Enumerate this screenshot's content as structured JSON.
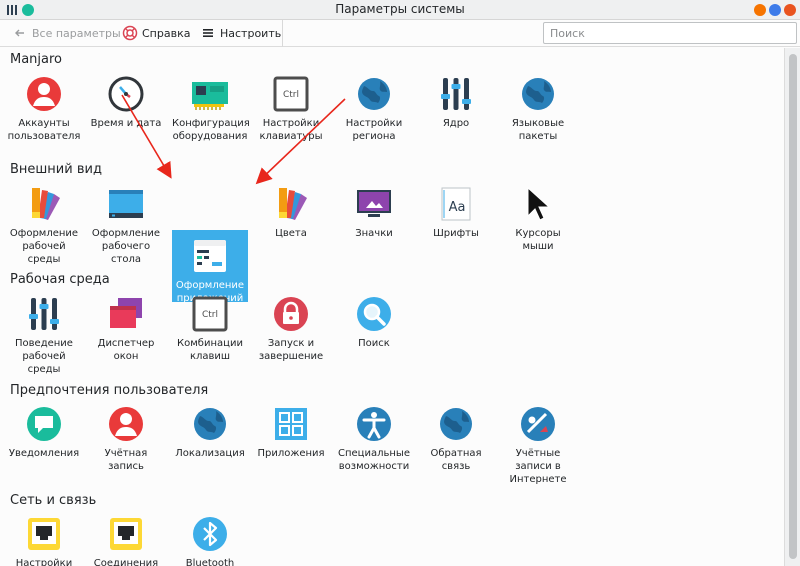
{
  "window": {
    "title": "Параметры системы"
  },
  "toolbar": {
    "back_label": "Все параметры",
    "help_label": "Справка",
    "configure_label": "Настроить",
    "search_placeholder": "Поиск"
  },
  "sections": [
    {
      "title": "Manjaro",
      "items": [
        {
          "label": "Аккаунты пользователя",
          "icon": "user-accounts-icon"
        },
        {
          "label": "Время и дата",
          "icon": "clock-icon"
        },
        {
          "label": "Конфигурация оборудования",
          "icon": "hardware-card-icon"
        },
        {
          "label": "Настройки клавиатуры",
          "icon": "keyboard-ctrl-icon"
        },
        {
          "label": "Настройки региона",
          "icon": "globe-icon"
        },
        {
          "label": "Ядро",
          "icon": "kernel-sliders-icon"
        },
        {
          "label": "Языковые пакеты",
          "icon": "globe-icon"
        }
      ]
    },
    {
      "title": "Внешний вид",
      "items": [
        {
          "label": "Оформление рабочей среды",
          "icon": "palette-swatch-icon"
        },
        {
          "label": "Оформление рабочего стола",
          "icon": "desktop-icon"
        },
        {
          "label": "Оформление приложений",
          "icon": "app-style-window-icon",
          "selected": true
        },
        {
          "label": "Цвета",
          "icon": "palette-swatch-icon"
        },
        {
          "label": "Значки",
          "icon": "monitor-icon"
        },
        {
          "label": "Шрифты",
          "icon": "fonts-icon"
        },
        {
          "label": "Курсоры мыши",
          "icon": "cursor-icon"
        }
      ]
    },
    {
      "title": "Рабочая среда",
      "items": [
        {
          "label": "Поведение рабочей среды",
          "icon": "kernel-sliders-icon"
        },
        {
          "label": "Диспетчер окон",
          "icon": "window-manager-icon"
        },
        {
          "label": "Комбинации клавиш",
          "icon": "keyboard-ctrl-icon"
        },
        {
          "label": "Запуск и завершение",
          "icon": "lock-icon"
        },
        {
          "label": "Поиск",
          "icon": "search-icon"
        }
      ]
    },
    {
      "title": "Предпочтения пользователя",
      "items": [
        {
          "label": "Уведомления",
          "icon": "notification-icon"
        },
        {
          "label": "Учётная запись",
          "icon": "user-accounts-icon"
        },
        {
          "label": "Локализация",
          "icon": "globe-icon"
        },
        {
          "label": "Приложения",
          "icon": "applications-grid-icon"
        },
        {
          "label": "Специальные возможности",
          "icon": "accessibility-icon"
        },
        {
          "label": "Обратная связь",
          "icon": "globe-icon"
        },
        {
          "label": "Учётные записи в Интернете",
          "icon": "online-accounts-icon"
        }
      ]
    },
    {
      "title": "Сеть и связь",
      "items": [
        {
          "label": "Настройки",
          "icon": "network-port-icon"
        },
        {
          "label": "Соединения",
          "icon": "network-port-icon"
        },
        {
          "label": "Bluetooth",
          "icon": "bluetooth-icon"
        }
      ]
    }
  ],
  "colors": {
    "accent": "#3daee9",
    "close": "#e95420",
    "arrow": "#e8271c"
  }
}
